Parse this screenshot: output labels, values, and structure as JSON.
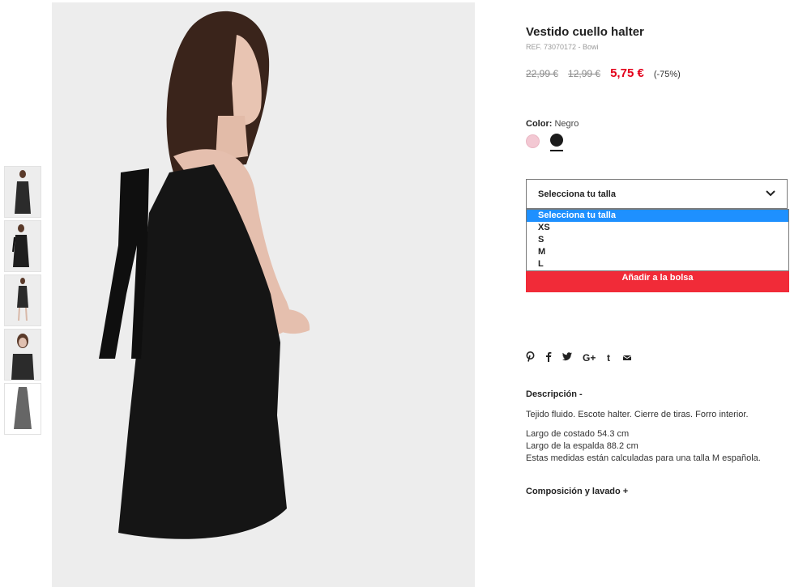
{
  "product": {
    "title": "Vestido cuello halter",
    "ref": "REF. 73070172 - Bowi",
    "price_original": "22,99 €",
    "price_previous": "12,99 €",
    "price_current": "5,75 €",
    "discount": "(-75%)"
  },
  "color": {
    "label": "Color:",
    "selected": "Negro",
    "swatches": [
      {
        "name": "pink",
        "hex": "#f3c8d3"
      },
      {
        "name": "black",
        "hex": "#1c1c1c"
      }
    ]
  },
  "size": {
    "placeholder": "Selecciona tu talla",
    "options": [
      "Selecciona tu talla",
      "XS",
      "S",
      "M",
      "L"
    ]
  },
  "add_to_bag": "Añadir a la bolsa",
  "share": {
    "icons": [
      "pinterest-icon",
      "facebook-icon",
      "twitter-icon",
      "google-plus-icon",
      "tumblr-icon",
      "email-icon"
    ],
    "glyphs": [
      "℗",
      "f",
      "🐦",
      "G+",
      "t",
      "✉"
    ]
  },
  "description": {
    "title": "Descripción -",
    "line1": "Tejido fluido. Escote halter. Cierre de tiras. Forro interior.",
    "line2": "Largo de costado 54.3 cm",
    "line3": "Largo de la espalda 88.2 cm",
    "line4": "Estas medidas están calculadas para una talla M española."
  },
  "composition": {
    "title": "Composición y lavado +"
  },
  "colors": {
    "accent": "#f12b38",
    "sale_price": "#e3001b",
    "highlight": "#1e90ff"
  }
}
